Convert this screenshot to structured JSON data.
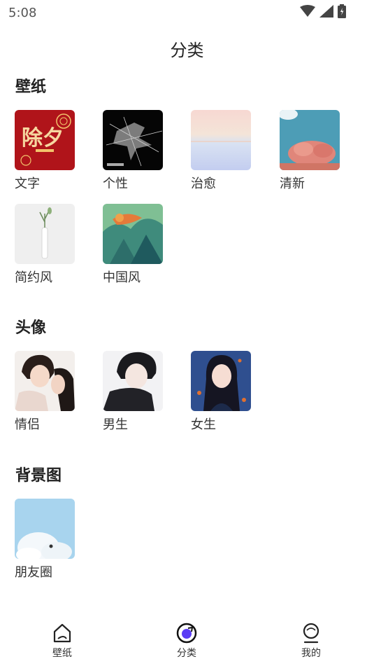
{
  "status_bar": {
    "time": "5:08"
  },
  "page_title": "分类",
  "sections": [
    {
      "title": "壁纸",
      "items": [
        {
          "label": "文字",
          "thumb_text": "除夕"
        },
        {
          "label": "个性"
        },
        {
          "label": "治愈"
        },
        {
          "label": "清新"
        },
        {
          "label": "简约风"
        },
        {
          "label": "中国风"
        }
      ]
    },
    {
      "title": "头像",
      "items": [
        {
          "label": "情侣"
        },
        {
          "label": "男生"
        },
        {
          "label": "女生"
        }
      ]
    },
    {
      "title": "背景图",
      "items": [
        {
          "label": "朋友圈"
        }
      ]
    }
  ],
  "tab_bar": {
    "tabs": [
      {
        "label": "壁纸",
        "icon": "wallpaper-icon",
        "active": false
      },
      {
        "label": "分类",
        "icon": "category-icon",
        "active": true
      },
      {
        "label": "我的",
        "icon": "profile-icon",
        "active": false
      }
    ]
  }
}
